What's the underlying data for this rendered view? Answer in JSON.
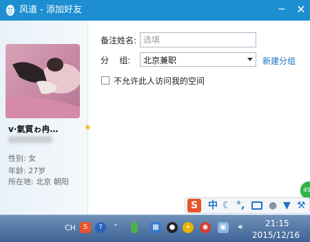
{
  "window": {
    "title": "风道 - 添加好友",
    "minimize_glyph": "─",
    "close_glyph": "✕"
  },
  "profile": {
    "nickname": "v·氣質ゎ冉…",
    "star_glyph": "★",
    "gender_label": "性别:",
    "gender": "女",
    "age_label": "年龄:",
    "age": "27岁",
    "location_label": "所在地:",
    "location": "北京  朝阳"
  },
  "form": {
    "remark_label": "备注姓名:",
    "remark_placeholder": "选填",
    "group_label": "分    组:",
    "group_value": "北京兼职",
    "new_group_link": "新建分组",
    "privacy_label": "不允许此人访问我的空间"
  },
  "badge": {
    "text": "49"
  },
  "ime": {
    "logo": "S",
    "mode": "中",
    "moon": "☾",
    "punct": "°,",
    "icons": [
      "keyboard-icon",
      "user-icon",
      "shirt-icon",
      "wrench-icon"
    ]
  },
  "taskbar": {
    "lang": "CH",
    "time": "21:15",
    "date": "2015/12/16"
  }
}
